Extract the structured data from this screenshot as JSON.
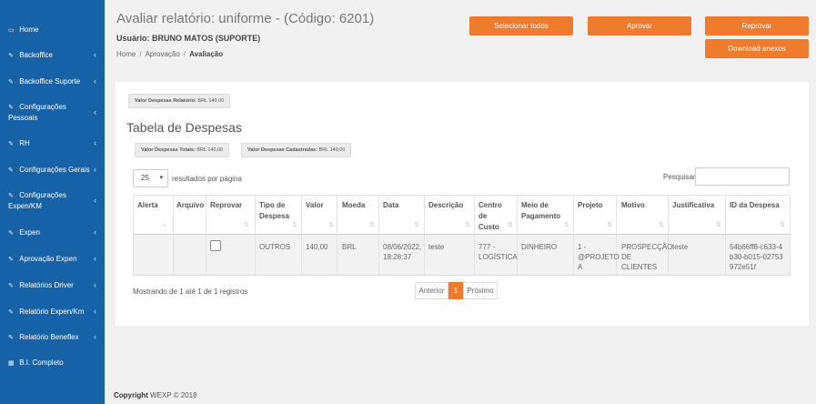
{
  "sidebar": {
    "items": [
      {
        "icon": "▭",
        "label": "Home",
        "chevron": ""
      },
      {
        "icon": "✎",
        "label": "Backoffice",
        "chevron": "‹"
      },
      {
        "icon": "✎",
        "label": "Backoffice Suporte",
        "chevron": "‹"
      },
      {
        "icon": "✎",
        "label": "Configurações",
        "label2": "Pessoais",
        "chevron": "‹"
      },
      {
        "icon": "✎",
        "label": "RH",
        "chevron": "‹"
      },
      {
        "icon": "✎",
        "label": "Configurações Gerais",
        "chevron": "‹"
      },
      {
        "icon": "✎",
        "label": "Configurações",
        "label2": "Expen/KM",
        "chevron": "‹"
      },
      {
        "icon": "✎",
        "label": "Expen",
        "chevron": "‹"
      },
      {
        "icon": "✎",
        "label": "Aprovação Expen",
        "chevron": "‹"
      },
      {
        "icon": "✎",
        "label": "Relatórios Driver",
        "chevron": "‹"
      },
      {
        "icon": "✎",
        "label": "Relatório Expen/Km",
        "chevron": "‹"
      },
      {
        "icon": "✎",
        "label": "Relatório Beneflex",
        "chevron": "‹"
      },
      {
        "icon": "▦",
        "label": "B.I. Completo",
        "chevron": ""
      }
    ]
  },
  "header": {
    "title": "Avaliar relatório: uniforme - (Código: 6201)",
    "user_label": "Usuário:",
    "user_name": "BRUNO MATOS (SUPORTE)",
    "breadcrumb": [
      "Home",
      "Aprovação",
      "Avaliação"
    ],
    "breadcrumb_sep": "/"
  },
  "actions": {
    "select_all": "Selecionar todos",
    "approve": "Aprovar",
    "reject": "Reprovar",
    "download": "Download anexos"
  },
  "summary": {
    "report_total_label": "Valor Despesas Relatório:",
    "report_total_value": "BRL 140,00",
    "table_title": "Tabela de Despesas",
    "total_label": "Valor Despesas Totais:",
    "total_value": "BRL 140,00",
    "registered_label": "Valor Despesas Cadastradas:",
    "registered_value": "BRL 140,00"
  },
  "table_controls": {
    "page_length": "25",
    "page_length_suffix": "resultados por página",
    "search_label": "Pesquisar",
    "search_value": ""
  },
  "table": {
    "columns": [
      "Alerta",
      "Arquivo",
      "Reprovar",
      "Tipo de Despesa",
      "Valor",
      "Moeda",
      "Data",
      "Descrição",
      "Centro de Custo",
      "Meio de Pagamento",
      "Projeto",
      "Motivo",
      "Justificativa",
      "ID da Despesa"
    ],
    "rows": [
      {
        "alerta": "",
        "arquivo": "",
        "tipo": "OUTROS",
        "valor": "140,00",
        "moeda": "BRL",
        "data": "08/06/2022, 18:28:37",
        "descricao": "teste",
        "centro": "777 - LOGÍSTICA",
        "meio": "DINHEIRO",
        "projeto": "1 - @PROJETO A",
        "motivo": "PROSPECÇÃO DE CLIENTES",
        "justificativa": "teste",
        "id": "54b66ff8-c633-4b30-b015-02753972e51f"
      }
    ]
  },
  "pagination": {
    "info": "Mostrando de 1 até 1 de 1 registros",
    "prev": "Anterior",
    "current": "1",
    "next": "Próximo"
  },
  "footer": {
    "copyright_label": "Copyright",
    "copyright_text": "WEXP © 2018"
  },
  "colors": {
    "sidebar": "#1762a6",
    "accent": "#ef7b2e",
    "background": "#f1f1f1"
  }
}
